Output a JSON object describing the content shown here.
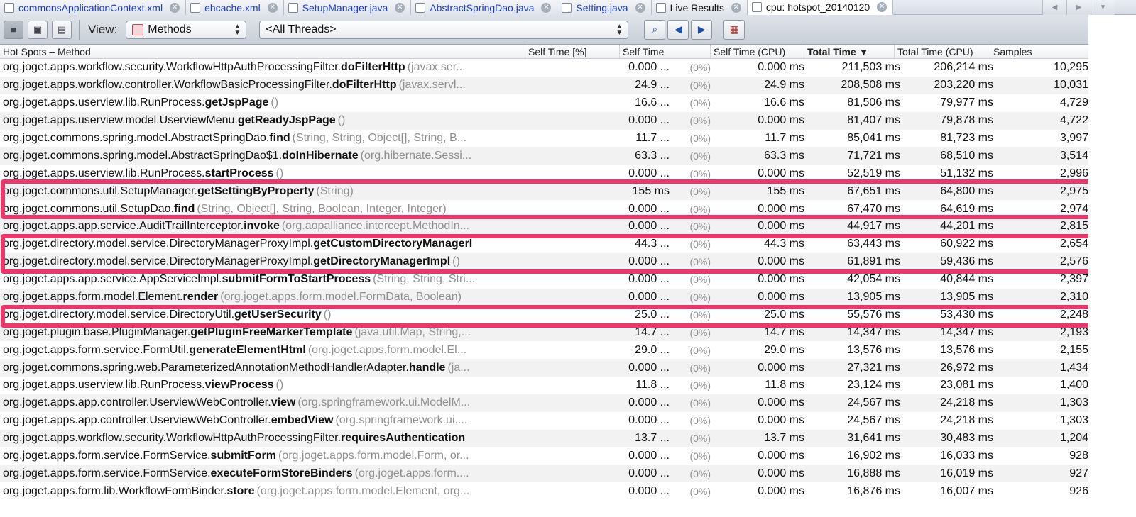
{
  "tabs": [
    {
      "label": "commonsApplicationContext.xml",
      "icon": "xml-file-icon"
    },
    {
      "label": "ehcache.xml",
      "icon": "xml-file-icon"
    },
    {
      "label": "SetupManager.java",
      "icon": "java-file-icon"
    },
    {
      "label": "AbstractSpringDao.java",
      "icon": "java-file-icon"
    },
    {
      "label": "Setting.java",
      "icon": "java-file-icon"
    },
    {
      "label": "Live Results",
      "icon": "live-results-icon"
    },
    {
      "label": "cpu: hotspot_20140120",
      "icon": "cpu-snapshot-icon"
    }
  ],
  "toolbar": {
    "view_label": "View:",
    "view_value": "Methods",
    "threads_value": "<All Threads>"
  },
  "columns": {
    "method": "Hot Spots – Method",
    "self_pct": "Self Time [%]",
    "self_time": "Self Time",
    "self_cpu": "Self Time (CPU)",
    "total_time": "Total Time",
    "total_cpu": "Total Time (CPU)",
    "samples": "Samples"
  },
  "rows": [
    {
      "cls": "org.joget.apps.workflow.security.WorkflowHttpAuthProcessingFilter.",
      "meth": "doFilterHttp",
      "sig": "(javax.ser...",
      "self": "0.000 ...",
      "pct": "(0%)",
      "cpu": "0.000 ms",
      "total": "211,503 ms",
      "tcpu": "206,214 ms",
      "samples": "10,295"
    },
    {
      "cls": "org.joget.apps.workflow.controller.WorkflowBasicProcessingFilter.",
      "meth": "doFilterHttp",
      "sig": "(javax.servl...",
      "self": "24.9 ...",
      "pct": "(0%)",
      "cpu": "24.9 ms",
      "total": "208,508 ms",
      "tcpu": "203,220 ms",
      "samples": "10,031"
    },
    {
      "cls": "org.joget.apps.userview.lib.RunProcess.",
      "meth": "getJspPage",
      "sig": "()",
      "self": "16.6 ...",
      "pct": "(0%)",
      "cpu": "16.6 ms",
      "total": "81,506 ms",
      "tcpu": "79,977 ms",
      "samples": "4,729"
    },
    {
      "cls": "org.joget.apps.userview.model.UserviewMenu.",
      "meth": "getReadyJspPage",
      "sig": "()",
      "self": "0.000 ...",
      "pct": "(0%)",
      "cpu": "0.000 ms",
      "total": "81,407 ms",
      "tcpu": "79,878 ms",
      "samples": "4,722"
    },
    {
      "cls": "org.joget.commons.spring.model.AbstractSpringDao.",
      "meth": "find",
      "sig": "(String, String, Object[], String, B...",
      "self": "11.7 ...",
      "pct": "(0%)",
      "cpu": "11.7 ms",
      "total": "85,041 ms",
      "tcpu": "81,723 ms",
      "samples": "3,997"
    },
    {
      "cls": "org.joget.commons.spring.model.AbstractSpringDao$1.",
      "meth": "doInHibernate",
      "sig": "(org.hibernate.Sessi...",
      "self": "63.3 ...",
      "pct": "(0%)",
      "cpu": "63.3 ms",
      "total": "71,721 ms",
      "tcpu": "68,510 ms",
      "samples": "3,514"
    },
    {
      "cls": "org.joget.apps.userview.lib.RunProcess.",
      "meth": "startProcess",
      "sig": "()",
      "self": "0.000 ...",
      "pct": "(0%)",
      "cpu": "0.000 ms",
      "total": "52,519 ms",
      "tcpu": "51,132 ms",
      "samples": "2,996"
    },
    {
      "cls": "org.joget.commons.util.SetupManager.",
      "meth": "getSettingByProperty",
      "sig": "(String)",
      "self": "155 ms",
      "pct": "(0%)",
      "cpu": "155 ms",
      "total": "67,651 ms",
      "tcpu": "64,800 ms",
      "samples": "2,975"
    },
    {
      "cls": "org.joget.commons.util.SetupDao.",
      "meth": "find",
      "sig": "(String, Object[], String, Boolean, Integer, Integer)",
      "self": "0.000 ...",
      "pct": "(0%)",
      "cpu": "0.000 ms",
      "total": "67,470 ms",
      "tcpu": "64,619 ms",
      "samples": "2,974"
    },
    {
      "cls": "org.joget.apps.app.service.AuditTrailInterceptor.",
      "meth": "invoke",
      "sig": "(org.aopalliance.intercept.MethodIn...",
      "self": "0.000 ...",
      "pct": "(0%)",
      "cpu": "0.000 ms",
      "total": "44,917 ms",
      "tcpu": "44,201 ms",
      "samples": "2,815"
    },
    {
      "cls": "org.joget.directory.model.service.DirectoryManagerProxyImpl.",
      "meth": "getCustomDirectoryManagerI",
      "sig": "",
      "self": "44.3 ...",
      "pct": "(0%)",
      "cpu": "44.3 ms",
      "total": "63,443 ms",
      "tcpu": "60,922 ms",
      "samples": "2,654"
    },
    {
      "cls": "org.joget.directory.model.service.DirectoryManagerProxyImpl.",
      "meth": "getDirectoryManagerImpl",
      "sig": "()",
      "self": "0.000 ...",
      "pct": "(0%)",
      "cpu": "0.000 ms",
      "total": "61,891 ms",
      "tcpu": "59,436 ms",
      "samples": "2,576"
    },
    {
      "cls": "org.joget.apps.app.service.AppServiceImpl.",
      "meth": "submitFormToStartProcess",
      "sig": "(String, String, Stri...",
      "self": "0.000 ...",
      "pct": "(0%)",
      "cpu": "0.000 ms",
      "total": "42,054 ms",
      "tcpu": "40,844 ms",
      "samples": "2,397"
    },
    {
      "cls": "org.joget.apps.form.model.Element.",
      "meth": "render",
      "sig": "(org.joget.apps.form.model.FormData, Boolean)",
      "self": "0.000 ...",
      "pct": "(0%)",
      "cpu": "0.000 ms",
      "total": "13,905 ms",
      "tcpu": "13,905 ms",
      "samples": "2,310"
    },
    {
      "cls": "org.joget.directory.model.service.DirectoryUtil.",
      "meth": "getUserSecurity",
      "sig": "()",
      "self": "25.0 ...",
      "pct": "(0%)",
      "cpu": "25.0 ms",
      "total": "55,576 ms",
      "tcpu": "53,430 ms",
      "samples": "2,248"
    },
    {
      "cls": "org.joget.plugin.base.PluginManager.",
      "meth": "getPluginFreeMarkerTemplate",
      "sig": "(java.util.Map, String,...",
      "self": "14.7 ...",
      "pct": "(0%)",
      "cpu": "14.7 ms",
      "total": "14,347 ms",
      "tcpu": "14,347 ms",
      "samples": "2,193"
    },
    {
      "cls": "org.joget.apps.form.service.FormUtil.",
      "meth": "generateElementHtml",
      "sig": "(org.joget.apps.form.model.El...",
      "self": "29.0 ...",
      "pct": "(0%)",
      "cpu": "29.0 ms",
      "total": "13,576 ms",
      "tcpu": "13,576 ms",
      "samples": "2,155"
    },
    {
      "cls": "org.joget.commons.spring.web.ParameterizedAnnotationMethodHandlerAdapter.",
      "meth": "handle",
      "sig": "(ja...",
      "self": "0.000 ...",
      "pct": "(0%)",
      "cpu": "0.000 ms",
      "total": "27,321 ms",
      "tcpu": "26,972 ms",
      "samples": "1,434"
    },
    {
      "cls": "org.joget.apps.userview.lib.RunProcess.",
      "meth": "viewProcess",
      "sig": "()",
      "self": "11.8 ...",
      "pct": "(0%)",
      "cpu": "11.8 ms",
      "total": "23,124 ms",
      "tcpu": "23,081 ms",
      "samples": "1,400"
    },
    {
      "cls": "org.joget.apps.app.controller.UserviewWebController.",
      "meth": "view",
      "sig": "(org.springframework.ui.ModelM...",
      "self": "0.000 ...",
      "pct": "(0%)",
      "cpu": "0.000 ms",
      "total": "24,567 ms",
      "tcpu": "24,218 ms",
      "samples": "1,303"
    },
    {
      "cls": "org.joget.apps.app.controller.UserviewWebController.",
      "meth": "embedView",
      "sig": "(org.springframework.ui....",
      "self": "0.000 ...",
      "pct": "(0%)",
      "cpu": "0.000 ms",
      "total": "24,567 ms",
      "tcpu": "24,218 ms",
      "samples": "1,303"
    },
    {
      "cls": "org.joget.apps.workflow.security.WorkflowHttpAuthProcessingFilter.",
      "meth": "requiresAuthentication",
      "sig": "",
      "self": "13.7 ...",
      "pct": "(0%)",
      "cpu": "13.7 ms",
      "total": "31,641 ms",
      "tcpu": "30,483 ms",
      "samples": "1,204"
    },
    {
      "cls": "org.joget.apps.form.service.FormService.",
      "meth": "submitForm",
      "sig": "(org.joget.apps.form.model.Form, or...",
      "self": "0.000 ...",
      "pct": "(0%)",
      "cpu": "0.000 ms",
      "total": "16,902 ms",
      "tcpu": "16,033 ms",
      "samples": "928"
    },
    {
      "cls": "org.joget.apps.form.service.FormService.",
      "meth": "executeFormStoreBinders",
      "sig": "(org.joget.apps.form....",
      "self": "0.000 ...",
      "pct": "(0%)",
      "cpu": "0.000 ms",
      "total": "16,888 ms",
      "tcpu": "16,019 ms",
      "samples": "927"
    },
    {
      "cls": "org.joget.apps.form.lib.WorkflowFormBinder.",
      "meth": "store",
      "sig": "(org.joget.apps.form.model.Element, org...",
      "self": "0.000 ...",
      "pct": "(0%)",
      "cpu": "0.000 ms",
      "total": "16,876 ms",
      "tcpu": "16,007 ms",
      "samples": "926"
    }
  ],
  "colors": {
    "highlight": "#f0356b",
    "link_tab": "#1a3fc1",
    "alt_row": "#f2f2f2"
  }
}
